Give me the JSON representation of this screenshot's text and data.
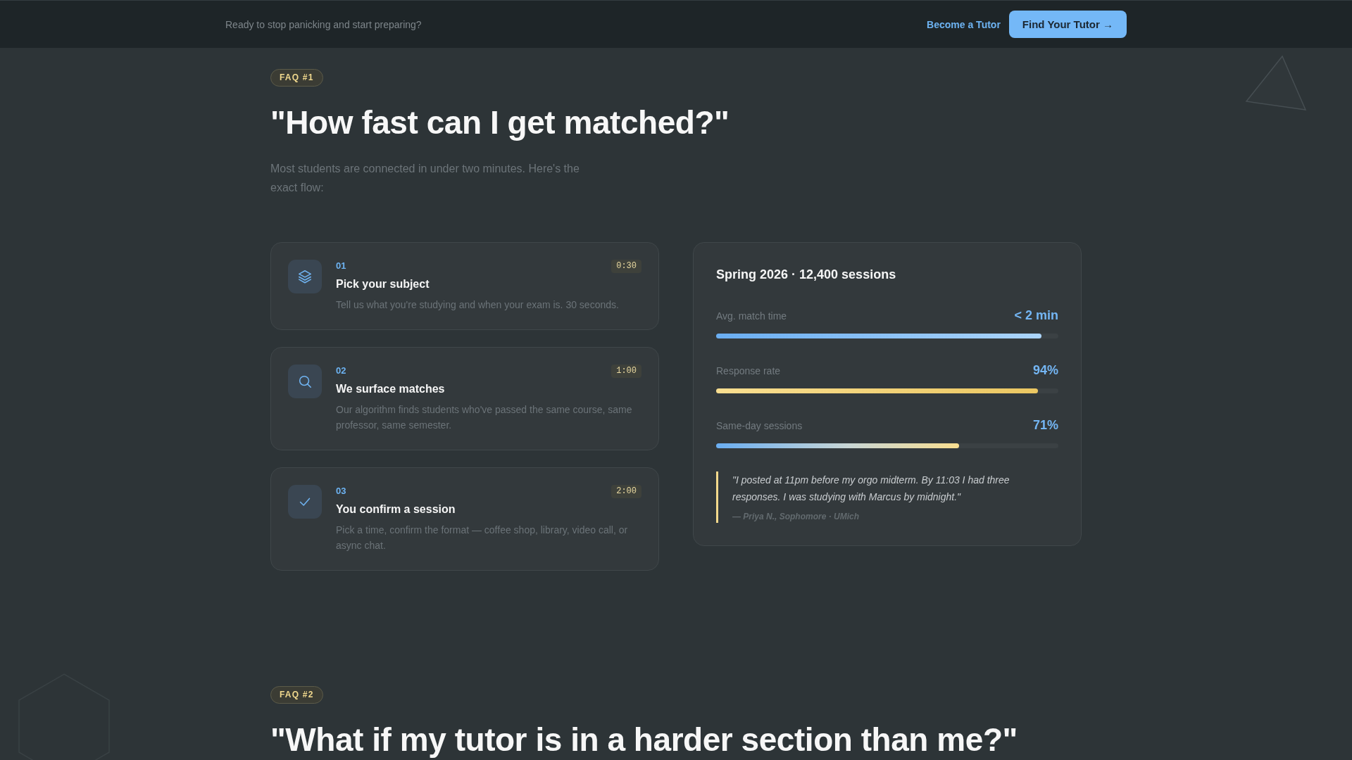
{
  "top_bar": {
    "tagline": "Ready to stop panicking and start preparing?",
    "link": "Become a Tutor",
    "button": "Find Your Tutor →"
  },
  "sections": [
    {
      "badge": "FAQ #1",
      "question": "\"How fast can I get matched?\"",
      "intro": "Most students are connected in under two minutes. Here's the exact flow:",
      "steps": [
        {
          "number": "01",
          "time": "0:30",
          "title": "Pick your subject",
          "text": "Tell us what you're studying and when your exam is. 30 seconds."
        },
        {
          "number": "02",
          "time": "1:00",
          "title": "We surface matches",
          "text": "Our algorithm finds students who've passed the same course, same professor, same semester."
        },
        {
          "number": "03",
          "time": "2:00",
          "title": "You confirm a session",
          "text": "Pick a time, confirm the format — coffee shop, library, video call, or async chat."
        }
      ],
      "stats_card": {
        "title": "Spring 2026 · 12,400 sessions",
        "metrics": [
          {
            "label": "Avg. match time",
            "value": "< 2 min",
            "level": 0.95,
            "kind": "cool"
          },
          {
            "label": "Response rate",
            "value": "94%",
            "level": 0.94,
            "kind": "warm"
          },
          {
            "label": "Same-day sessions",
            "value": "71%",
            "level": 0.71,
            "kind": "blend"
          }
        ],
        "quote": {
          "text": "\"I posted at 11pm before my orgo midterm. By 11:03 I had three responses. I was studying with Marcus by midnight.\"",
          "attribution": "— Priya N., Sophomore · UMich"
        }
      }
    },
    {
      "badge": "FAQ #2",
      "question": "\"What if my tutor is in a harder section than me?\""
    }
  ]
}
